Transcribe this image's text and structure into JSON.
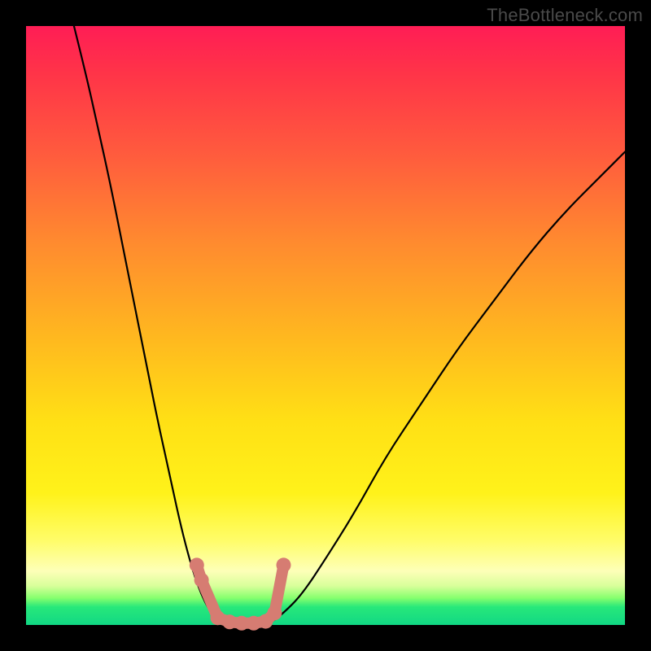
{
  "watermark": "TheBottleneck.com",
  "colors": {
    "frame": "#000000",
    "curve": "#000000",
    "marker": "#d67c72",
    "gradient_stops": [
      "#ff1d55",
      "#ff3448",
      "#ff5d3d",
      "#ff8a2f",
      "#ffb81f",
      "#ffe015",
      "#fff21a",
      "#fffd6a",
      "#fdffb8",
      "#d8ff9a",
      "#86ff6e",
      "#28e87a",
      "#11d884"
    ]
  },
  "chart_data": {
    "type": "line",
    "title": "",
    "xlabel": "",
    "ylabel": "",
    "xlim": [
      0,
      100
    ],
    "ylim": [
      0,
      100
    ],
    "grid": false,
    "legend": false,
    "series": [
      {
        "name": "left-curve",
        "x": [
          8,
          10,
          12,
          14,
          16,
          18,
          20,
          22,
          24,
          25.5,
          27,
          28.5,
          30,
          31.5,
          33
        ],
        "y": [
          100,
          92,
          83,
          74,
          64,
          54,
          44,
          34,
          25,
          18,
          12,
          7,
          3.5,
          1.2,
          0.3
        ]
      },
      {
        "name": "valley-floor",
        "x": [
          33,
          35,
          37,
          39,
          41
        ],
        "y": [
          0.3,
          0,
          0,
          0,
          0.5
        ]
      },
      {
        "name": "right-curve",
        "x": [
          41,
          43,
          46,
          50,
          55,
          60,
          66,
          72,
          78,
          84,
          90,
          96,
          100
        ],
        "y": [
          0.5,
          2,
          5,
          11,
          19,
          28,
          37,
          46,
          54,
          62,
          69,
          75,
          79
        ]
      }
    ],
    "markers": [
      {
        "name": "left-knuckle-top",
        "x": 28.5,
        "y": 10
      },
      {
        "name": "left-knuckle-mid",
        "x": 29.3,
        "y": 7.5
      },
      {
        "name": "valley-blob-1",
        "x": 32,
        "y": 1.2
      },
      {
        "name": "valley-blob-2",
        "x": 34,
        "y": 0.5
      },
      {
        "name": "valley-blob-3",
        "x": 36,
        "y": 0.3
      },
      {
        "name": "valley-blob-4",
        "x": 38,
        "y": 0.3
      },
      {
        "name": "valley-blob-5",
        "x": 40,
        "y": 0.6
      },
      {
        "name": "right-knuckle",
        "x": 41.5,
        "y": 2
      },
      {
        "name": "right-tip",
        "x": 43,
        "y": 10
      }
    ]
  }
}
